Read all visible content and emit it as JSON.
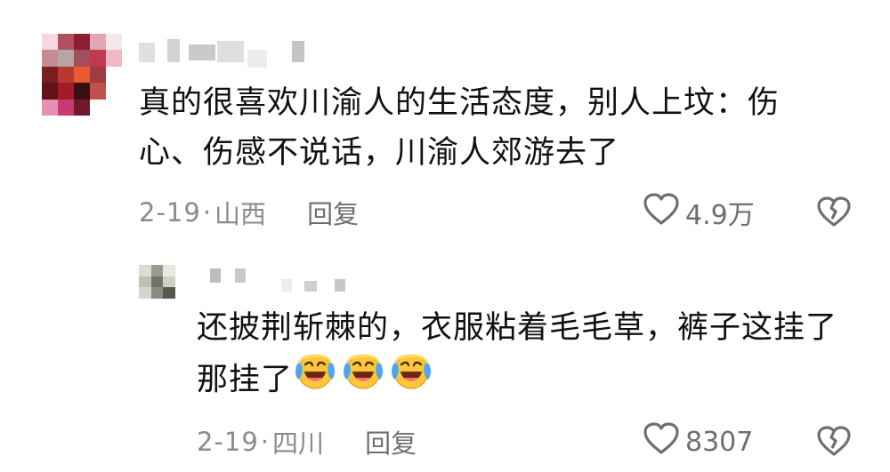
{
  "comment": {
    "avatar_colors": [
      "#f3d8dd",
      "#b05061",
      "#8a1f33",
      "#e3a6b6",
      "#f6e7ea",
      "#c58c95",
      "#b6a5a6",
      "#a14e5d",
      "#c23a4d",
      "#eeb8c4",
      "#7b1e1f",
      "#b53a2f",
      "#e95a2e",
      "#9e3b43",
      "#ffffff",
      "#5d1519",
      "#a41a25",
      "#3a0f14",
      "#c2504a",
      "#ffffff",
      "#e98fb3",
      "#c53a73",
      "#6e1a2a",
      "#ffffff",
      "#ffffff"
    ],
    "text": "真的很喜欢川渝人的生活态度，别人上坟：伤心、伤感不说话，川渝人郊游去了",
    "date": "2-19",
    "dot": "·",
    "location": "山西",
    "reply_label": "回复",
    "likes": "4.9万"
  },
  "reply": {
    "avatar_colors": [
      "#dcdcd4",
      "#9a9a8e",
      "#e8e8e2",
      "#ffffff",
      "#bfbfb2",
      "#707566",
      "#cfcfc7",
      "#ffffff",
      "#d6d6ce",
      "#8b8d80",
      "#555a4e",
      "#ffffff"
    ],
    "text": "还披荆斩棘的，衣服粘着毛毛草，裤子这挂了那挂了",
    "emoji": [
      "laughing-crying-emoji",
      "laughing-crying-emoji",
      "laughing-crying-emoji"
    ],
    "date": "2-19",
    "dot": "·",
    "location": "四川",
    "reply_label": "回复",
    "likes": "8307"
  },
  "colors": {
    "meta": "#8b8b8b",
    "icon": "#6f6f6f",
    "text": "#111111",
    "emoji_yellow": "#ffc63a",
    "emoji_blue": "#4ea6f0"
  }
}
